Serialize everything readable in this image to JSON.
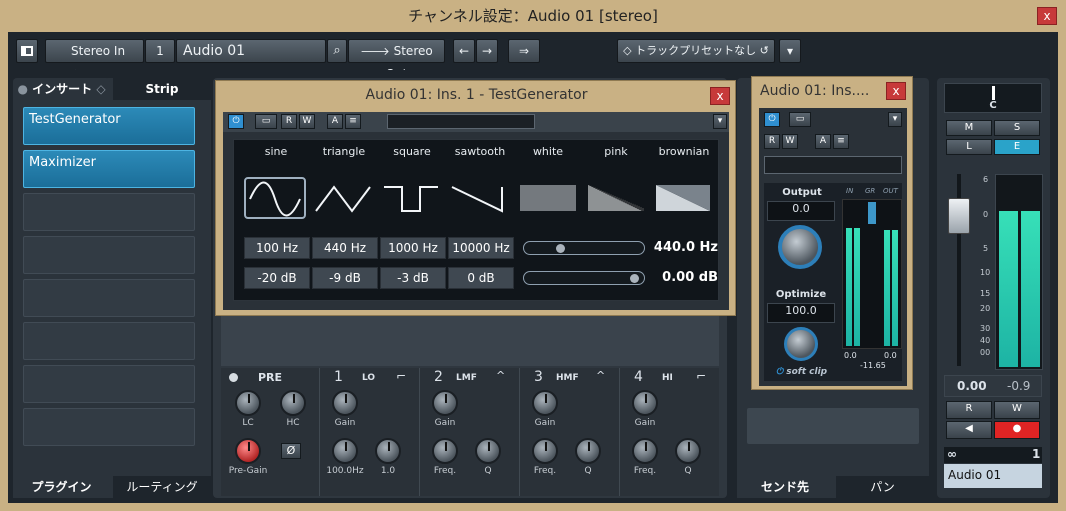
{
  "window": {
    "title": "チャンネル設定：Audio 01 [stereo]",
    "close": "x"
  },
  "toolbar": {
    "input": "Stereo In",
    "input_arrow": "🡐",
    "channel_number": "1",
    "channel_name": "Audio 01",
    "output": "Stereo Out",
    "output_arrow": "🡒",
    "preset": "トラックプリセットなし",
    "preset_icon": "◇",
    "reload_icon": "↺",
    "menu_icon": "▾"
  },
  "left_panel": {
    "tab_inserts": "インサート",
    "tab_strip": "Strip",
    "slots": [
      "TestGenerator",
      "Maximizer"
    ],
    "bottom_tab_plugins": "プラグイン",
    "bottom_tab_routing": "ルーティング"
  },
  "eq": {
    "pre_label": "PRE",
    "lc": "LC",
    "hc": "HC",
    "pregain": "Pre-Gain",
    "phase": "Ø",
    "bands": [
      {
        "num": "1",
        "name": "LO",
        "gain": "Gain",
        "freq": "100.0Hz",
        "q": "1.0"
      },
      {
        "num": "2",
        "name": "LMF",
        "gain": "Gain",
        "freq": "Freq.",
        "q": "Q"
      },
      {
        "num": "3",
        "name": "HMF",
        "gain": "Gain",
        "freq": "Freq.",
        "q": "Q"
      },
      {
        "num": "4",
        "name": "HI",
        "gain": "Gain",
        "freq": "Freq.",
        "q": "Q"
      }
    ]
  },
  "testgen": {
    "title": "Audio 01: Ins. 1 - TestGenerator",
    "close": "x",
    "waves": [
      "sine",
      "triangle",
      "square",
      "sawtooth",
      "white",
      "pink",
      "brownian"
    ],
    "freqs": [
      "100 Hz",
      "440 Hz",
      "1000 Hz",
      "10000 Hz"
    ],
    "freq_value": "440.0 Hz",
    "levels": [
      "-20 dB",
      "-9 dB",
      "-3 dB",
      "0 dB"
    ],
    "level_value": "0.00 dB",
    "freq_slider_pos": 0.3,
    "level_slider_pos": 0.98
  },
  "maximizer": {
    "title": "Audio 01: Ins....",
    "close": "x",
    "output_label": "Output",
    "output_value": "0.0",
    "optimize_label": "Optimize",
    "optimize_value": "100.0",
    "softclip": "soft clip",
    "meter_in": "IN",
    "meter_gr": "GR",
    "meter_out": "OUT",
    "in_value": "0.0",
    "out_value": "0.0",
    "gr_value": "-11.65"
  },
  "sends": {
    "tab_sends": "センド先",
    "tab_pan": "パン"
  },
  "fader": {
    "m": "M",
    "s": "S",
    "l": "L",
    "e": "E",
    "r": "R",
    "w": "W",
    "volume": "0.00",
    "peak": "-0.9",
    "scale": [
      "6",
      "0",
      "5",
      "10",
      "15",
      "20",
      "30",
      "40",
      "00"
    ],
    "level": 0.82,
    "link_icon": "∞",
    "channel_num": "1",
    "channel_name": "Audio 01"
  },
  "colors": {
    "accent": "#1b7fb3",
    "frame": "#c9b184",
    "meter": "#2bd2b0",
    "record": "#e02424",
    "edit": "#2aa3c9"
  }
}
